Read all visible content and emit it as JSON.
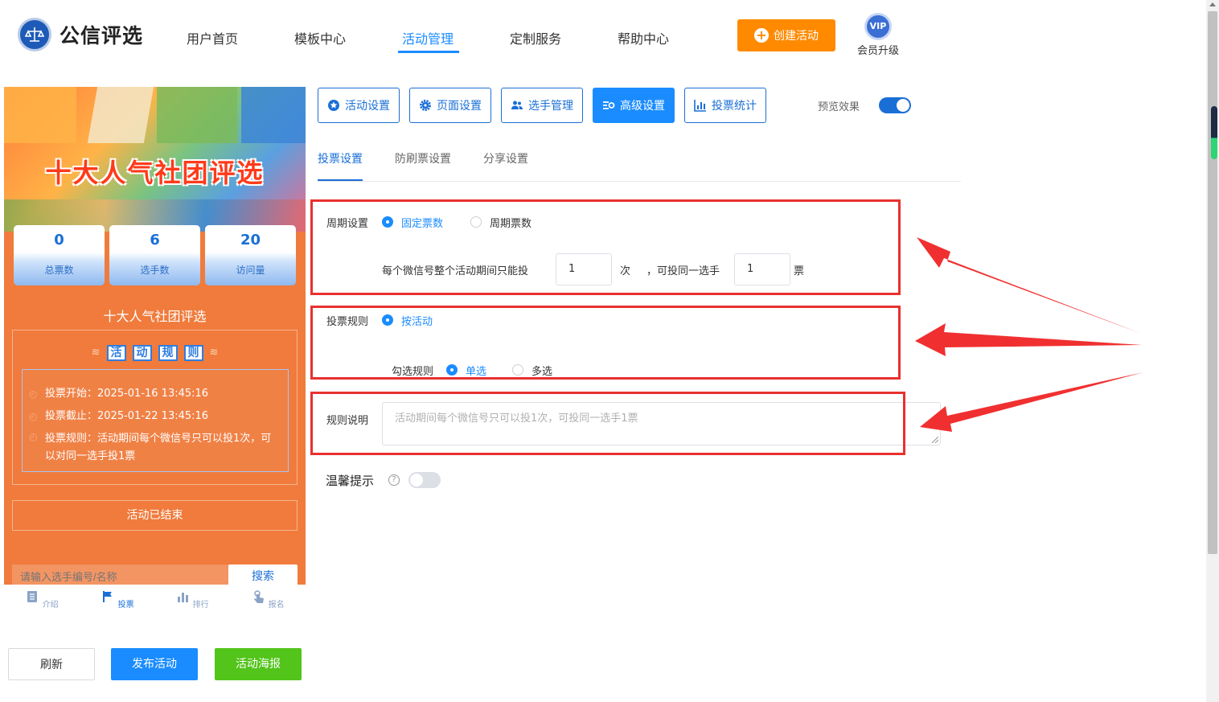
{
  "brand": {
    "name": "公信评选"
  },
  "nav": {
    "items": [
      "用户首页",
      "模板中心",
      "活动管理",
      "定制服务",
      "帮助中心"
    ],
    "active": "活动管理",
    "create_label": "创建活动",
    "vip_badge": "VIP",
    "vip_label": "会员升级"
  },
  "preview": {
    "banner_title": "十大人气社团评选",
    "stats": [
      {
        "value": "0",
        "label": "总票数"
      },
      {
        "value": "6",
        "label": "选手数"
      },
      {
        "value": "20",
        "label": "访问量"
      }
    ],
    "title": "十大人气社团评选",
    "rules_heading": [
      "活",
      "动",
      "规",
      "则"
    ],
    "rules": {
      "start": "投票开始：2025-01-16 13:45:16",
      "end": "投票截止：2025-01-22 13:45:16",
      "rule": "投票规则：活动期间每个微信号只可以投1次，可以对同一选手投1票"
    },
    "ended": "活动已结束",
    "search_placeholder": "请输入选手编号/名称",
    "search_button": "搜索",
    "tabs": [
      {
        "label": "介绍",
        "icon": "document-icon"
      },
      {
        "label": "投票",
        "icon": "flag-icon"
      },
      {
        "label": "排行",
        "icon": "bar-chart-icon"
      },
      {
        "label": "报名",
        "icon": "hand-pointer-icon"
      }
    ],
    "active_tab": "投票"
  },
  "actions": {
    "refresh": "刷新",
    "publish": "发布活动",
    "poster": "活动海报"
  },
  "settings_tabs": [
    {
      "label": "活动设置",
      "icon": "star-icon"
    },
    {
      "label": "页面设置",
      "icon": "gear-icon"
    },
    {
      "label": "选手管理",
      "icon": "users-icon"
    },
    {
      "label": "高级设置",
      "icon": "sliders-icon"
    },
    {
      "label": "投票统计",
      "icon": "bar-chart-icon"
    }
  ],
  "active_settings_tab": "高级设置",
  "preview_toggle": {
    "label": "预览效果",
    "on": true
  },
  "sub_tabs": [
    "投票设置",
    "防刷票设置",
    "分享设置"
  ],
  "active_sub_tab": "投票设置",
  "form": {
    "period": {
      "label": "周期设置",
      "options": [
        "固定票数",
        "周期票数"
      ],
      "selected": "固定票数",
      "sentence_prefix": "每个微信号整个活动期间只能投",
      "count_value": "1",
      "unit_times": "次",
      "sentence_mid": "，可投同一选手",
      "per_player_value": "1",
      "unit_votes": "票"
    },
    "vote_rule": {
      "label": "投票规则",
      "option": "按活动",
      "check_label": "勾选规则",
      "check_options": [
        "单选",
        "多选"
      ],
      "check_selected": "单选"
    },
    "rule_desc": {
      "label": "规则说明",
      "placeholder": "活动期间每个微信号只可以投1次，可投同一选手1票"
    },
    "tip": {
      "label": "温馨提示",
      "help": "?",
      "on": false
    }
  },
  "colors": {
    "primary": "#1a8cff",
    "create": "#ff8a00",
    "highlight": "#e8312f",
    "poster": "#52c41a"
  }
}
